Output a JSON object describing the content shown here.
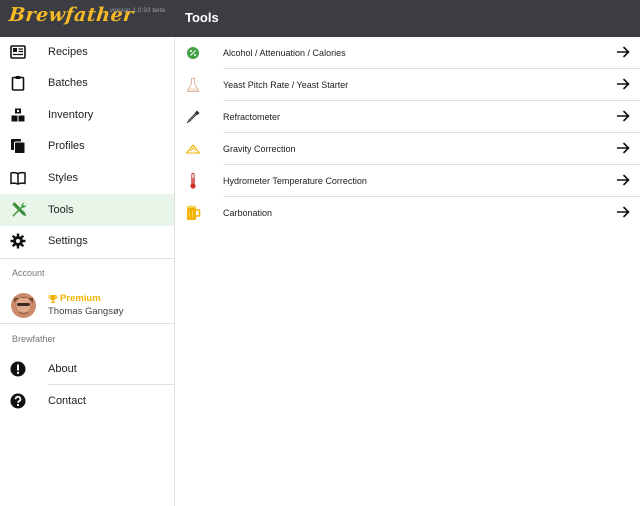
{
  "brand": {
    "name": "Brewfather",
    "version": "version 1.0.93 beta"
  },
  "nav": {
    "items": [
      {
        "label": "Recipes",
        "icon": "recipes-icon"
      },
      {
        "label": "Batches",
        "icon": "clipboard-icon"
      },
      {
        "label": "Inventory",
        "icon": "inventory-icon"
      },
      {
        "label": "Profiles",
        "icon": "copy-icon"
      },
      {
        "label": "Styles",
        "icon": "book-icon"
      },
      {
        "label": "Tools",
        "icon": "tools-icon",
        "active": true
      },
      {
        "label": "Settings",
        "icon": "gear-icon"
      }
    ]
  },
  "account": {
    "section_label": "Account",
    "premium_label": "Premium",
    "user_name": "Thomas Gangsøy"
  },
  "about_section": {
    "section_label": "Brewfather",
    "items": [
      {
        "label": "About",
        "icon": "info-icon"
      },
      {
        "label": "Contact",
        "icon": "help-icon"
      }
    ]
  },
  "main": {
    "title": "Tools",
    "tools": [
      {
        "label": "Alcohol / Attenuation / Calories",
        "icon": "percent-icon"
      },
      {
        "label": "Yeast Pitch Rate / Yeast Starter",
        "icon": "flask-icon"
      },
      {
        "label": "Refractometer",
        "icon": "pipette-icon"
      },
      {
        "label": "Gravity Correction",
        "icon": "triangle-icon"
      },
      {
        "label": "Hydrometer Temperature Correction",
        "icon": "thermometer-icon"
      },
      {
        "label": "Carbonation",
        "icon": "beer-mug-icon"
      }
    ]
  },
  "colors": {
    "topbar": "#3b3d42",
    "brand_accent": "#f5b928",
    "active_bg": "#e9f5e9",
    "tools_green": "#43a047",
    "premium_gold": "#f2b300"
  }
}
